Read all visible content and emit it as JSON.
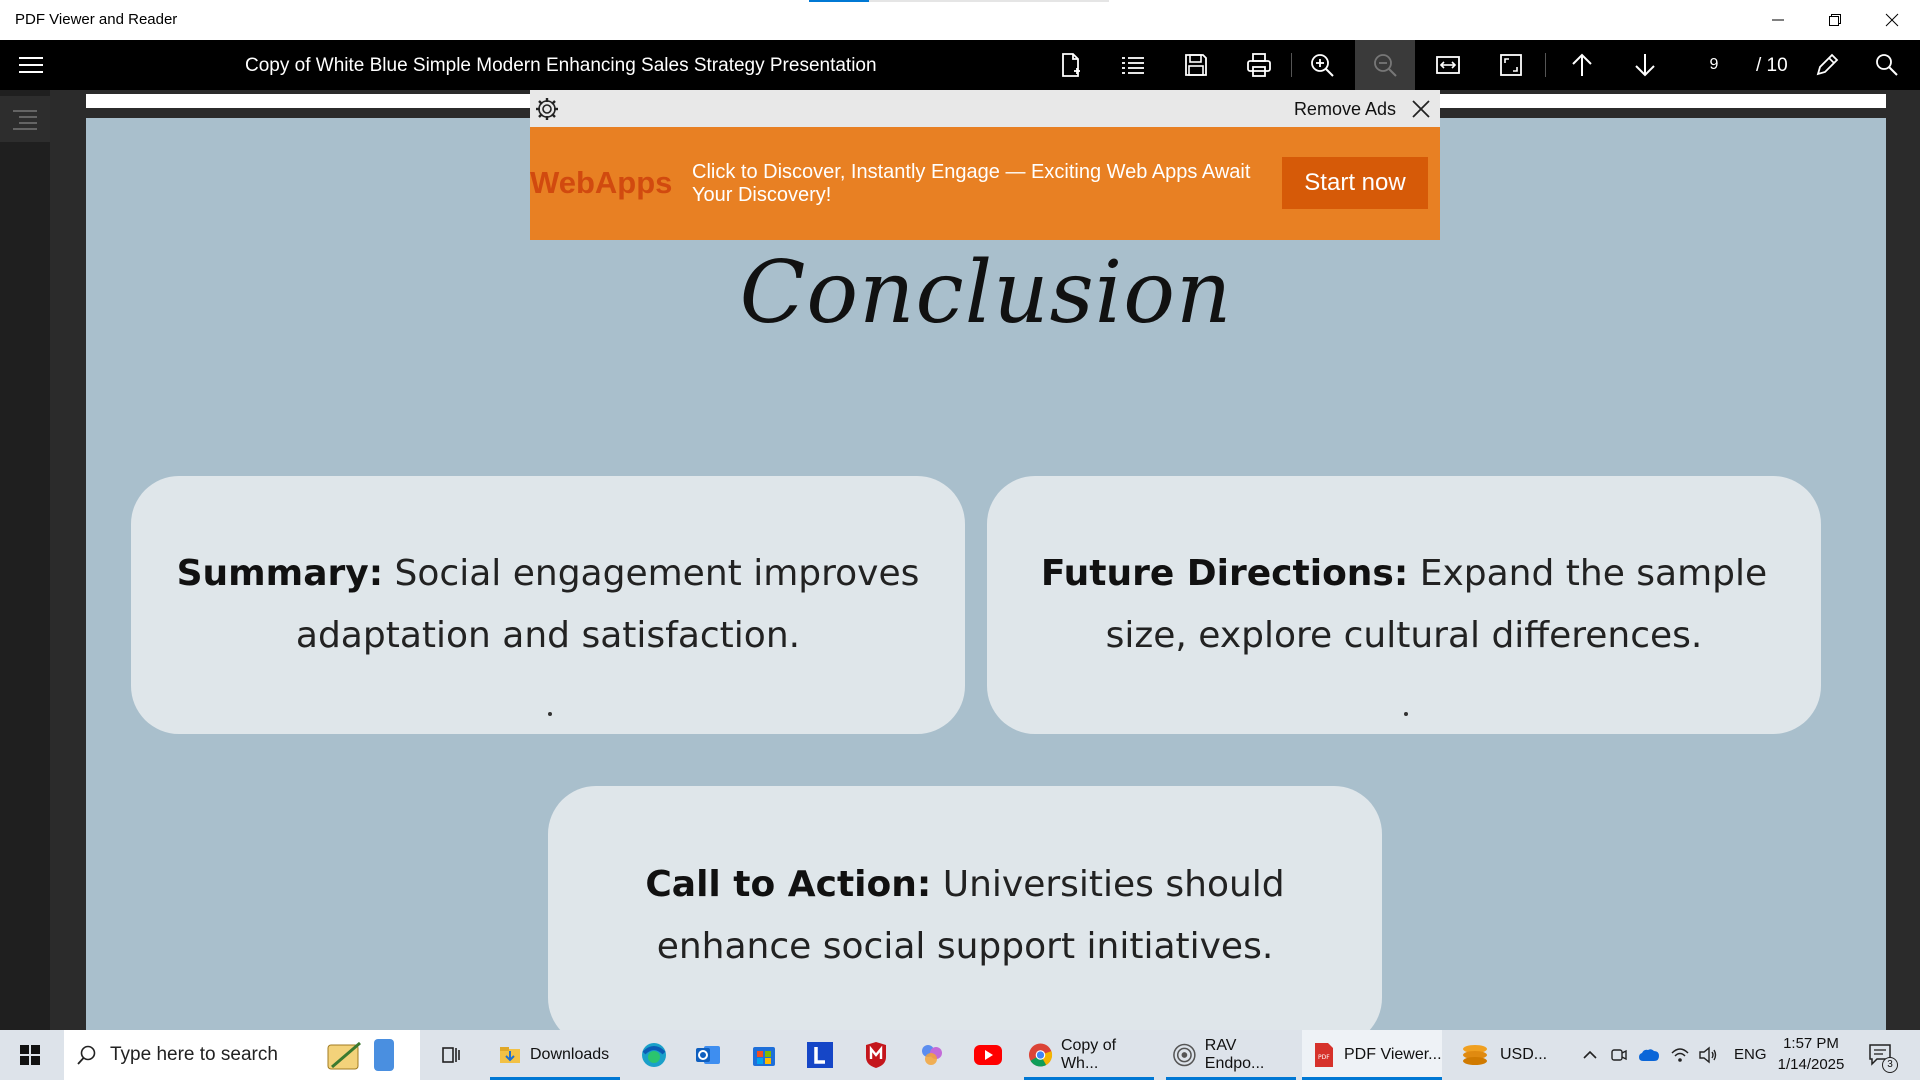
{
  "window": {
    "app_title": "PDF Viewer and Reader"
  },
  "toolbar": {
    "doc_title": "Copy of White Blue Simple Modern Enhancing Sales Strategy Presentation",
    "page_current": "9",
    "page_total": "/ 10",
    "icons": [
      "new-document-icon",
      "list-icon",
      "save-icon",
      "print-icon",
      "zoom-in-icon",
      "zoom-out-icon",
      "fit-width-icon",
      "fit-page-icon",
      "arrow-up-icon",
      "arrow-down-icon",
      "pen-icon",
      "search-icon"
    ]
  },
  "ad": {
    "remove_label": "Remove Ads",
    "logo": "WebApps",
    "text": "Click to Discover, Instantly Engage — Exciting Web Apps Await Your Discovery!",
    "cta": "Start now",
    "bg_color": "#e88023"
  },
  "slide": {
    "title": "Conclusion",
    "cards": [
      {
        "heading": "Summary:",
        "body": " Social engagement improves adaptation and satisfaction."
      },
      {
        "heading": "Future Directions:",
        "body": " Expand the sample size, explore cultural differences."
      },
      {
        "heading": "Call to Action:",
        "body": " Universities should enhance social support initiatives."
      }
    ],
    "bg_color": "#a9bfcc",
    "card_color": "#dfe6ea"
  },
  "taskbar": {
    "search_placeholder": "Type here to search",
    "apps": [
      {
        "label": "Downloads"
      },
      {
        "label": "Copy of Wh..."
      },
      {
        "label": "RAV Endpo..."
      },
      {
        "label": "PDF Viewer..."
      },
      {
        "label": "USD..."
      }
    ],
    "language": "ENG",
    "time": "1:57 PM",
    "date": "1/14/2025",
    "notification_count": "3"
  }
}
